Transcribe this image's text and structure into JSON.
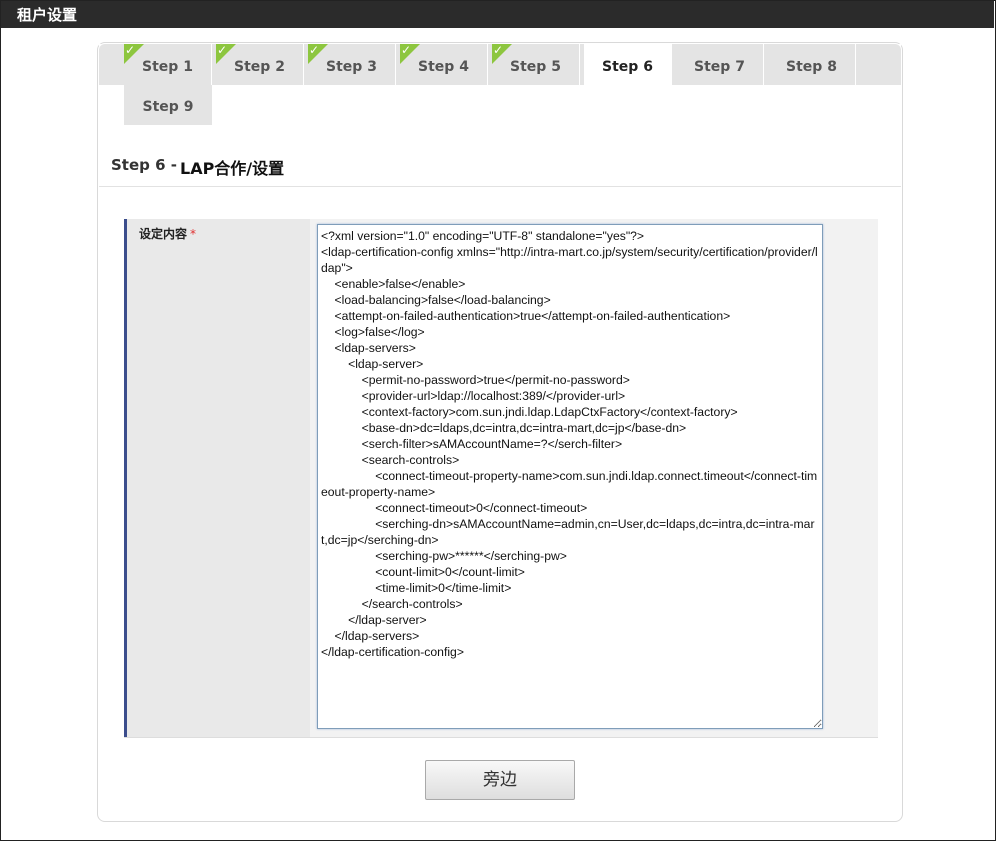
{
  "window": {
    "title": "租户设置"
  },
  "steps": [
    {
      "label": "Step 1",
      "completed": true
    },
    {
      "label": "Step 2",
      "completed": true
    },
    {
      "label": "Step 3",
      "completed": true
    },
    {
      "label": "Step 4",
      "completed": true
    },
    {
      "label": "Step 5",
      "completed": true
    },
    {
      "label": "Step 6",
      "active": true
    },
    {
      "label": "Step 7"
    },
    {
      "label": "Step 8"
    },
    {
      "label": "Step 9"
    }
  ],
  "section": {
    "prefix": "Step 6 -",
    "title": "LAP合作/设置"
  },
  "form": {
    "field_label": "设定内容",
    "required_mark": "*",
    "config_value": "<?xml version=\"1.0\" encoding=\"UTF-8\" standalone=\"yes\"?>\n<ldap-certification-config xmlns=\"http://intra-mart.co.jp/system/security/certification/provider/ldap\">\n    <enable>false</enable>\n    <load-balancing>false</load-balancing>\n    <attempt-on-failed-authentication>true</attempt-on-failed-authentication>\n    <log>false</log>\n    <ldap-servers>\n        <ldap-server>\n            <permit-no-password>true</permit-no-password>\n            <provider-url>ldap://localhost:389/</provider-url>\n            <context-factory>com.sun.jndi.ldap.LdapCtxFactory</context-factory>\n            <base-dn>dc=ldaps,dc=intra,dc=intra-mart,dc=jp</base-dn>\n            <serch-filter>sAMAccountName=?</serch-filter>\n            <search-controls>\n                <connect-timeout-property-name>com.sun.jndi.ldap.connect.timeout</connect-timeout-property-name>\n                <connect-timeout>0</connect-timeout>\n                <serching-dn>sAMAccountName=admin,cn=User,dc=ldaps,dc=intra,dc=intra-mart,dc=jp</serching-dn>\n                <serching-pw>******</serching-pw>\n                <count-limit>0</count-limit>\n                <time-limit>0</time-limit>\n            </search-controls>\n        </ldap-server>\n    </ldap-servers>\n</ldap-certification-config>"
  },
  "buttons": {
    "submit_label": "旁边"
  },
  "colors": {
    "check": "#8dc63f",
    "active_tab": "#ffffff",
    "inactive_tab": "#e4e4e4",
    "label_accent": "#3b4d8c",
    "required": "#e03030"
  }
}
